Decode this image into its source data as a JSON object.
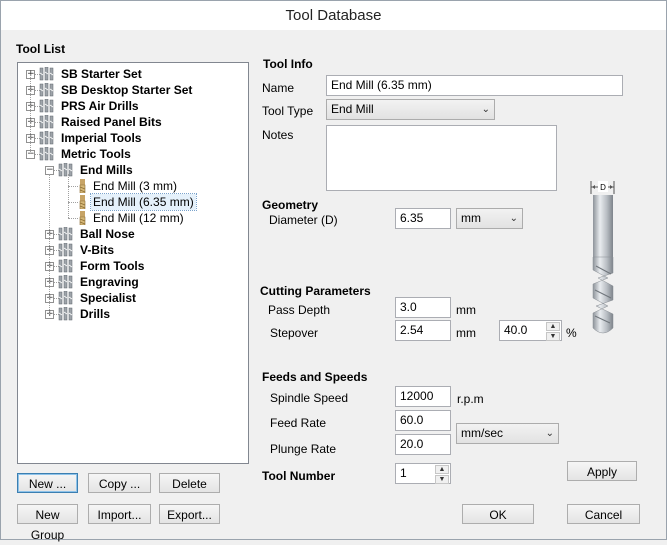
{
  "window": {
    "title": "Tool Database"
  },
  "tool_list": {
    "title": "Tool List",
    "items": [
      {
        "label": "SB Starter Set",
        "level": 0,
        "expander": "+",
        "icon": "tool-group-icon",
        "bold": true
      },
      {
        "label": "SB Desktop Starter Set",
        "level": 0,
        "expander": "+",
        "icon": "tool-group-icon",
        "bold": true
      },
      {
        "label": "PRS Air Drills",
        "level": 0,
        "expander": "+",
        "icon": "tool-group-icon",
        "bold": true
      },
      {
        "label": "Raised Panel Bits",
        "level": 0,
        "expander": "+",
        "icon": "tool-group-icon",
        "bold": true
      },
      {
        "label": "Imperial Tools",
        "level": 0,
        "expander": "+",
        "icon": "tool-group-icon",
        "bold": true
      },
      {
        "label": "Metric Tools",
        "level": 0,
        "expander": "-",
        "icon": "tool-group-icon",
        "bold": true
      },
      {
        "label": "End Mills",
        "level": 1,
        "expander": "-",
        "icon": "tool-group-icon",
        "bold": true
      },
      {
        "label": "End Mill (3 mm)",
        "level": 2,
        "expander": "",
        "icon": "end-mill-icon",
        "bold": false
      },
      {
        "label": "End Mill (6.35 mm)",
        "level": 2,
        "expander": "",
        "icon": "end-mill-icon",
        "bold": false,
        "selected": true
      },
      {
        "label": "End Mill (12 mm)",
        "level": 2,
        "expander": "",
        "icon": "end-mill-icon",
        "bold": false
      },
      {
        "label": "Ball Nose",
        "level": 1,
        "expander": "+",
        "icon": "tool-group-icon",
        "bold": true
      },
      {
        "label": "V-Bits",
        "level": 1,
        "expander": "+",
        "icon": "tool-group-icon",
        "bold": true
      },
      {
        "label": "Form Tools",
        "level": 1,
        "expander": "+",
        "icon": "tool-group-icon",
        "bold": true
      },
      {
        "label": "Engraving",
        "level": 1,
        "expander": "+",
        "icon": "tool-group-icon",
        "bold": true
      },
      {
        "label": "Specialist",
        "level": 1,
        "expander": "+",
        "icon": "tool-group-icon",
        "bold": true
      },
      {
        "label": "Drills",
        "level": 1,
        "expander": "+",
        "icon": "tool-group-icon",
        "bold": true
      }
    ]
  },
  "buttons": {
    "new": "New ...",
    "copy": "Copy ...",
    "delete": "Delete",
    "new_group": "New Group",
    "import": "Import...",
    "export": "Export...",
    "apply": "Apply",
    "ok": "OK",
    "cancel": "Cancel"
  },
  "tool_info": {
    "title": "Tool Info",
    "name_label": "Name",
    "name_value": "End Mill (6.35 mm)",
    "type_label": "Tool Type",
    "type_value": "End Mill",
    "notes_label": "Notes",
    "notes_value": ""
  },
  "geometry": {
    "title": "Geometry",
    "diameter_label": "Diameter (D)",
    "diameter_value": "6.35",
    "unit_value": "mm",
    "diagram_label": "D"
  },
  "cutting": {
    "title": "Cutting Parameters",
    "pass_depth_label": "Pass Depth",
    "pass_depth_value": "3.0",
    "pass_depth_unit": "mm",
    "stepover_label": "Stepover",
    "stepover_value": "2.54",
    "stepover_unit": "mm",
    "stepover_percent": "40.0",
    "percent_sign": "%"
  },
  "feeds": {
    "title": "Feeds and Speeds",
    "spindle_label": "Spindle Speed",
    "spindle_value": "12000",
    "spindle_unit": "r.p.m",
    "feed_label": "Feed Rate",
    "feed_value": "60.0",
    "plunge_label": "Plunge Rate",
    "plunge_value": "20.0",
    "rate_unit": "mm/sec"
  },
  "tool_number": {
    "label": "Tool Number",
    "value": "1"
  },
  "colors": {
    "selection": "#e5f1fb",
    "default_button_border": "#3c7fb1"
  }
}
